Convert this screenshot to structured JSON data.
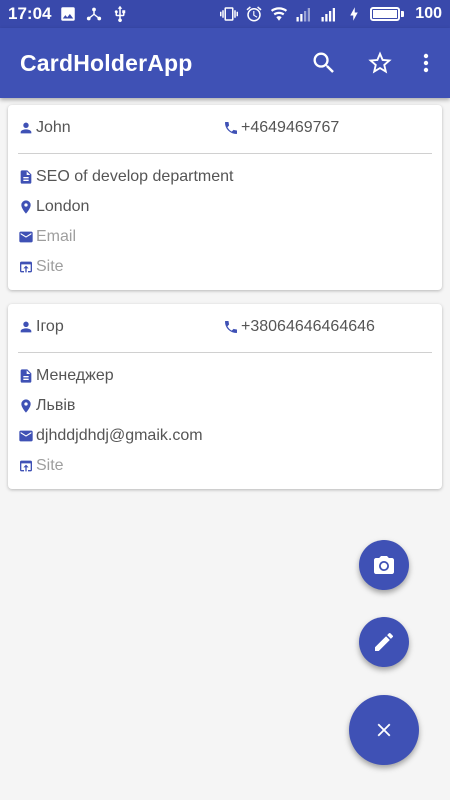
{
  "status_bar": {
    "time": "17:04",
    "battery_level": "100",
    "battery_fraction": 1.0
  },
  "app_bar": {
    "title": "CardHolderApp",
    "actions": [
      "search-icon",
      "star-outline-icon",
      "more-vert-icon"
    ]
  },
  "cards": [
    {
      "name": "John",
      "phone": "+4649469767",
      "position": "SEO of develop department",
      "city": "London",
      "email": "Email",
      "email_is_placeholder": true,
      "site": "Site",
      "site_is_placeholder": true
    },
    {
      "name": "Ігор",
      "phone": "+38064646464646",
      "position": "Менеджер",
      "city": "Львів",
      "email": "djhddjdhdj@gmaik.com",
      "email_is_placeholder": false,
      "site": "Site",
      "site_is_placeholder": true
    }
  ],
  "fabs": [
    "camera-icon",
    "edit-icon",
    "close-icon"
  ],
  "colors": {
    "primary": "#3f51b5",
    "primary_dark": "#3949ab",
    "background": "#f5f5f5",
    "placeholder_text": "#9e9e9e"
  }
}
